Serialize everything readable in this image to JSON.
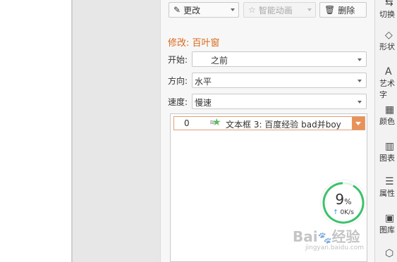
{
  "toolbar": {
    "change_label": "更改",
    "smart_anim_label": "智能动画",
    "delete_label": "删除"
  },
  "section_title": "修改: 百叶窗",
  "fields": {
    "start_label": "开始:",
    "start_value": "之前",
    "direction_label": "方向:",
    "direction_value": "水平",
    "speed_label": "速度:",
    "speed_value": "慢速"
  },
  "animation_list": [
    {
      "order": "0",
      "name": "文本框 3: 百度经验 bad并boy"
    }
  ],
  "sidebar": {
    "items": [
      {
        "label": "切换",
        "icon": "transition-icon"
      },
      {
        "label": "形状",
        "icon": "shapes-icon"
      },
      {
        "label": "艺术字",
        "icon": "wordart-icon"
      },
      {
        "label": "颜色",
        "icon": "color-icon"
      },
      {
        "label": "图表",
        "icon": "chart-icon"
      },
      {
        "label": "属性",
        "icon": "properties-icon"
      },
      {
        "label": "图库",
        "icon": "gallery-icon"
      }
    ]
  },
  "speed_widget": {
    "percent": "9",
    "percent_sign": "%",
    "rate": "0K/s",
    "accent": "#3cc26b"
  },
  "watermark": {
    "brand": "Bai",
    "brand2": "经验",
    "url": "jingyan.baidu.com"
  }
}
